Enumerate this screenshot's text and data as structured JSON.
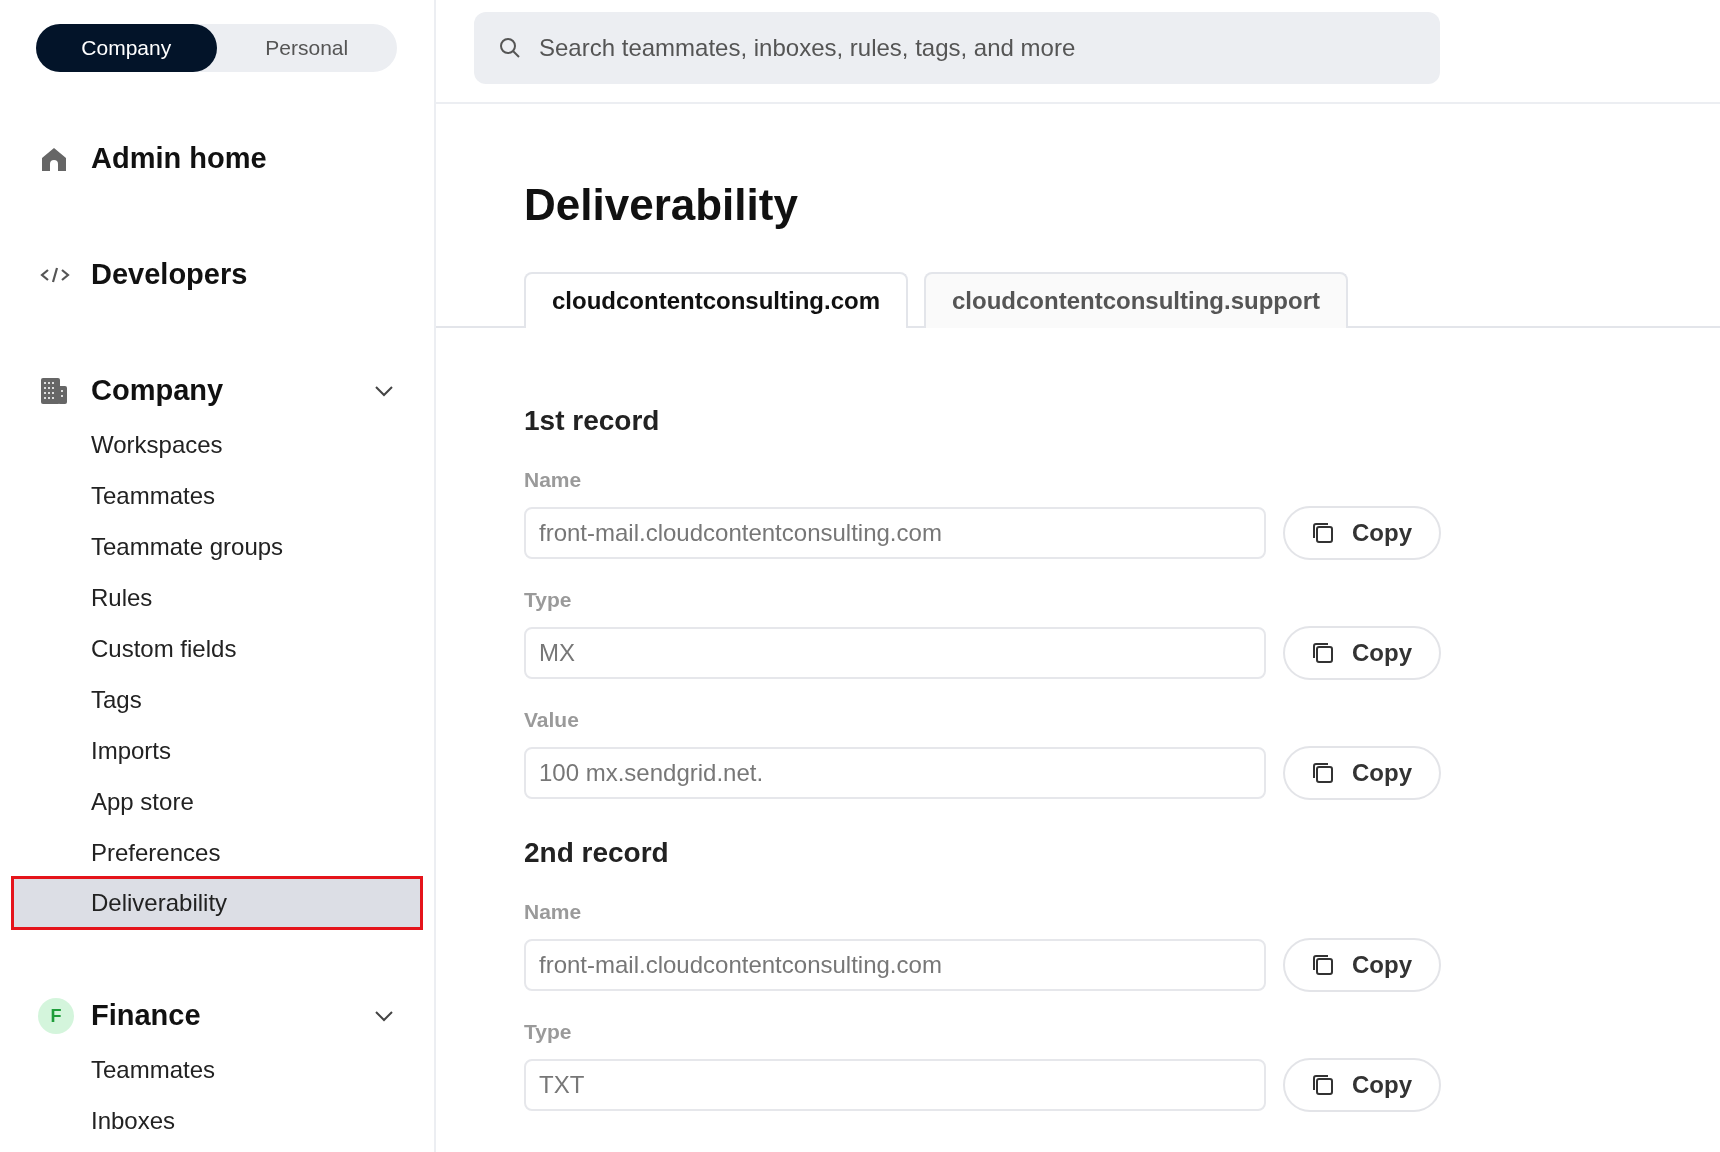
{
  "scope_toggle": [
    {
      "label": "Company",
      "selected": true
    },
    {
      "label": "Personal",
      "selected": false
    }
  ],
  "sidebar": {
    "top_items": [
      {
        "kind": "home",
        "label": "Admin home"
      },
      {
        "kind": "code",
        "label": "Developers"
      }
    ],
    "sections": [
      {
        "kind": "building",
        "label": "Company",
        "expanded": true,
        "items": [
          {
            "label": "Workspaces",
            "selected": false
          },
          {
            "label": "Teammates",
            "selected": false
          },
          {
            "label": "Teammate groups",
            "selected": false
          },
          {
            "label": "Rules",
            "selected": false
          },
          {
            "label": "Custom fields",
            "selected": false
          },
          {
            "label": "Tags",
            "selected": false
          },
          {
            "label": "Imports",
            "selected": false
          },
          {
            "label": "App store",
            "selected": false
          },
          {
            "label": "Preferences",
            "selected": false
          },
          {
            "label": "Deliverability",
            "selected": true
          }
        ]
      },
      {
        "kind": "letter",
        "badge": "F",
        "color": "#d4f5dc",
        "label": "Finance",
        "expanded": true,
        "items": [
          {
            "label": "Teammates",
            "selected": false
          },
          {
            "label": "Inboxes",
            "selected": false
          }
        ]
      }
    ]
  },
  "search": {
    "placeholder": "Search teammates, inboxes, rules, tags, and more"
  },
  "page_title": "Deliverability",
  "domain_tabs": [
    {
      "label": "cloudcontentconsulting.com",
      "selected": true
    },
    {
      "label": "cloudcontentconsulting.support",
      "selected": false
    }
  ],
  "records": [
    {
      "title": "1st record",
      "fields": [
        {
          "label": "Name",
          "value": "front-mail.cloudcontentconsulting.com",
          "button": "Copy"
        },
        {
          "label": "Type",
          "value": "MX",
          "button": "Copy"
        },
        {
          "label": "Value",
          "value": "100 mx.sendgrid.net.",
          "button": "Copy"
        }
      ]
    },
    {
      "title": "2nd record",
      "fields": [
        {
          "label": "Name",
          "value": "front-mail.cloudcontentconsulting.com",
          "button": "Copy"
        },
        {
          "label": "Type",
          "value": "TXT",
          "button": "Copy"
        }
      ]
    }
  ]
}
